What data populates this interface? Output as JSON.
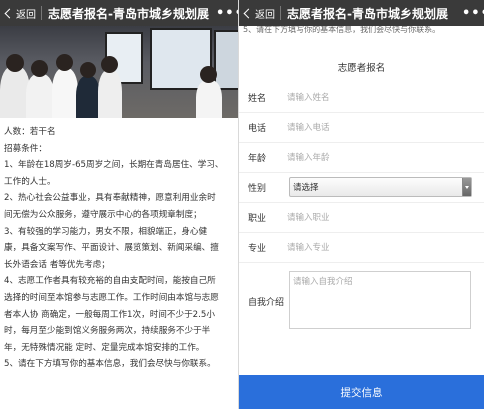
{
  "left": {
    "nav": {
      "back_label": "返回",
      "title": "志愿者报名-青岛市城乡规划展",
      "more_label": "•••"
    },
    "content": {
      "lines": [
        "人数：若干名",
        "招募条件：",
        "1、年龄在18周岁-65周岁之间，长期在青岛居住、学习、",
        "工作的人士。",
        "2、热心社会公益事业，具有奉献精神，愿意利用业余时",
        "间无偿为公众服务，遵守展示中心的各项规章制度；",
        "3、有较强的学习能力，男女不限，相貌端正，身心健",
        "康，具备文案写作、平面设计、展览策划、新闻采编、擅",
        "长外语会话 者等优先考虑；",
        "4、志愿工作者具有较充裕的自由支配时间，能按自己所",
        "选择的时间至本馆参与志愿工作。工作时间由本馆与志愿",
        "者本人协 商确定，一般每周工作1次，时间不少于2.5小",
        "时，每月至少能到馆义务服务两次，持续服务不少于半",
        "年，无特殊情况能 定时、定量完成本馆安排的工作。",
        "5、请在下方填写你的基本信息，我们会尽快与你联系。"
      ]
    }
  },
  "right": {
    "nav": {
      "back_label": "返回",
      "title": "志愿者报名-青岛市城乡规划展",
      "more_label": "•••"
    },
    "peek_text": "5、请在下方填写你的基本信息，我们会尽快与你联系。",
    "form": {
      "title": "志愿者报名",
      "fields": [
        {
          "label": "姓名",
          "placeholder": "请输入姓名"
        },
        {
          "label": "电话",
          "placeholder": "请输入电话"
        },
        {
          "label": "年龄",
          "placeholder": "请输入年龄"
        },
        {
          "label": "性别",
          "value": "请选择"
        },
        {
          "label": "职业",
          "placeholder": "请输入职业"
        },
        {
          "label": "专业",
          "placeholder": "请输入专业"
        },
        {
          "label": "自我介绍",
          "placeholder": "请输入自我介绍"
        }
      ],
      "submit_label": "提交信息"
    }
  },
  "colors": {
    "navbar": "#3a3a3a",
    "submit": "#2a6fdb",
    "background": "#ffffff"
  }
}
